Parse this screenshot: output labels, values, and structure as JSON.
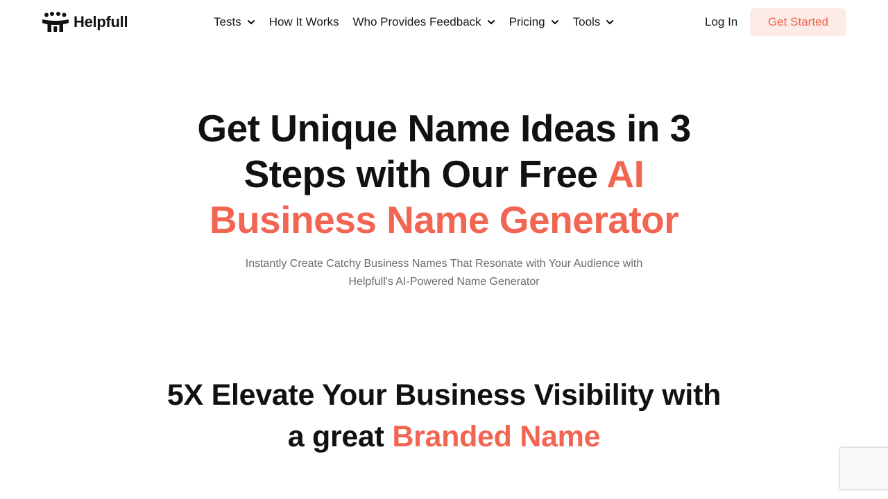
{
  "header": {
    "logo_text": "Helpfull",
    "nav": [
      {
        "label": "Tests",
        "has_dropdown": true
      },
      {
        "label": "How It Works",
        "has_dropdown": false
      },
      {
        "label": "Who Provides Feedback",
        "has_dropdown": true
      },
      {
        "label": "Pricing",
        "has_dropdown": true
      },
      {
        "label": "Tools",
        "has_dropdown": true
      }
    ],
    "login_label": "Log In",
    "cta_label": "Get Started"
  },
  "hero": {
    "title_part1": "Get Unique Name Ideas in 3 Steps with Our Free ",
    "title_highlight": "AI Business Name Generator",
    "subtitle": "Instantly Create Catchy Business Names That Resonate with Your Audience with Helpfull's AI-Powered Name Generator"
  },
  "section": {
    "title_part1": "5X Elevate Your Business Visibility with a great ",
    "title_highlight": "Branded Name"
  },
  "colors": {
    "accent": "#f26552",
    "cta_bg": "#fdebe5",
    "text": "#111111",
    "muted": "#6b6b6b"
  },
  "icons": [
    "helpfull-logo-icon",
    "chevron-down-icon"
  ]
}
